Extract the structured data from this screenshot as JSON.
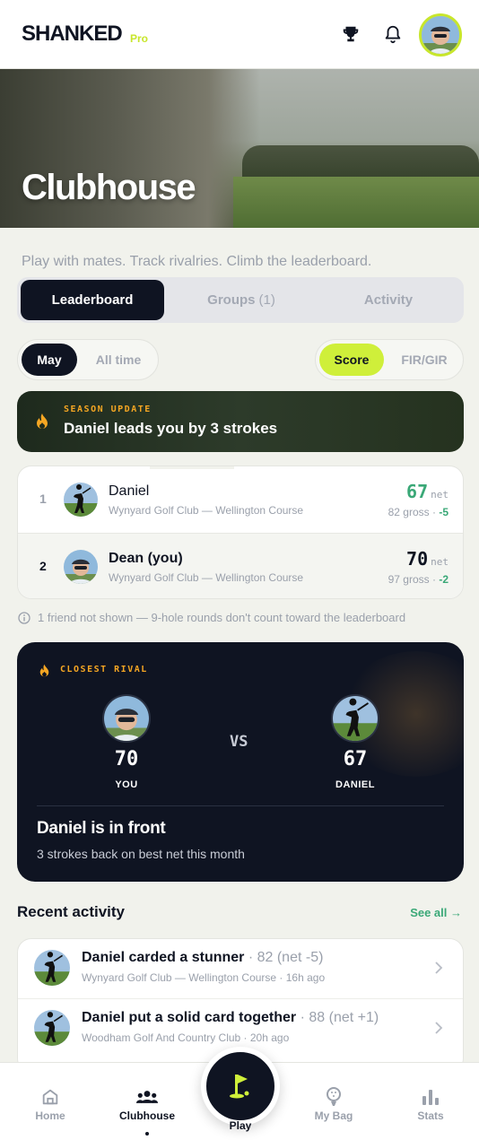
{
  "header": {
    "brand": "SHANKED",
    "badge": "Pro"
  },
  "hero": {
    "title": "Clubhouse"
  },
  "tagline": "Play with mates. Track rivalries. Climb the leaderboard.",
  "tabs": [
    {
      "label": "Leaderboard",
      "count": ""
    },
    {
      "label": "Groups",
      "count": "(1)"
    },
    {
      "label": "Activity",
      "count": ""
    }
  ],
  "period": {
    "options": [
      "May",
      "All time"
    ],
    "selected": "May"
  },
  "metric": {
    "options": [
      "Score",
      "FIR/GIR"
    ],
    "selected": "Score"
  },
  "season": {
    "label": "SEASON UPDATE",
    "text": "Daniel leads you by 3 strokes"
  },
  "leaderboard": [
    {
      "rank": "1",
      "name": "Daniel",
      "course": "Wynyard Golf Club — Wellington Course",
      "net": "67",
      "net_unit": "net",
      "gross": "82 gross · ",
      "diff": "-5"
    },
    {
      "rank": "2",
      "name": "Dean (you)",
      "course": "Wynyard Golf Club — Wellington Course",
      "net": "70",
      "net_unit": "net",
      "gross": "97 gross · ",
      "diff": "-2"
    }
  ],
  "note": "1 friend not shown — 9-hole rounds don't count toward the leaderboard",
  "rival": {
    "label": "CLOSEST RIVAL",
    "vs": "VS",
    "you": {
      "score": "70",
      "name": "YOU"
    },
    "them": {
      "score": "67",
      "name": "DANIEL"
    },
    "headline": "Daniel is in front",
    "sub": "3 strokes back on best net this month"
  },
  "recent": {
    "title": "Recent activity",
    "see_all": "See all →",
    "items": [
      {
        "bold": "Daniel carded a stunner",
        "detail": " · 82 (net -5)",
        "sub": "Wynyard Golf Club — Wellington Course · 16h ago"
      },
      {
        "bold": "Daniel put a solid card together",
        "detail": " · 88 (net +1)",
        "sub": "Woodham Golf And Country Club · 20h ago"
      }
    ]
  },
  "nav": {
    "items": [
      {
        "label": "Home",
        "icon": "home-icon"
      },
      {
        "label": "Clubhouse",
        "icon": "people-icon"
      },
      {
        "label": "Play",
        "icon": "flag-icon"
      },
      {
        "label": "My Bag",
        "icon": "golf-ball-icon"
      },
      {
        "label": "Stats",
        "icon": "bar-chart-icon"
      }
    ],
    "active": "Clubhouse"
  },
  "colors": {
    "accent": "#cfef3a",
    "dark": "#0f1422",
    "positive": "#3aa877",
    "flame": "#f5a623"
  }
}
